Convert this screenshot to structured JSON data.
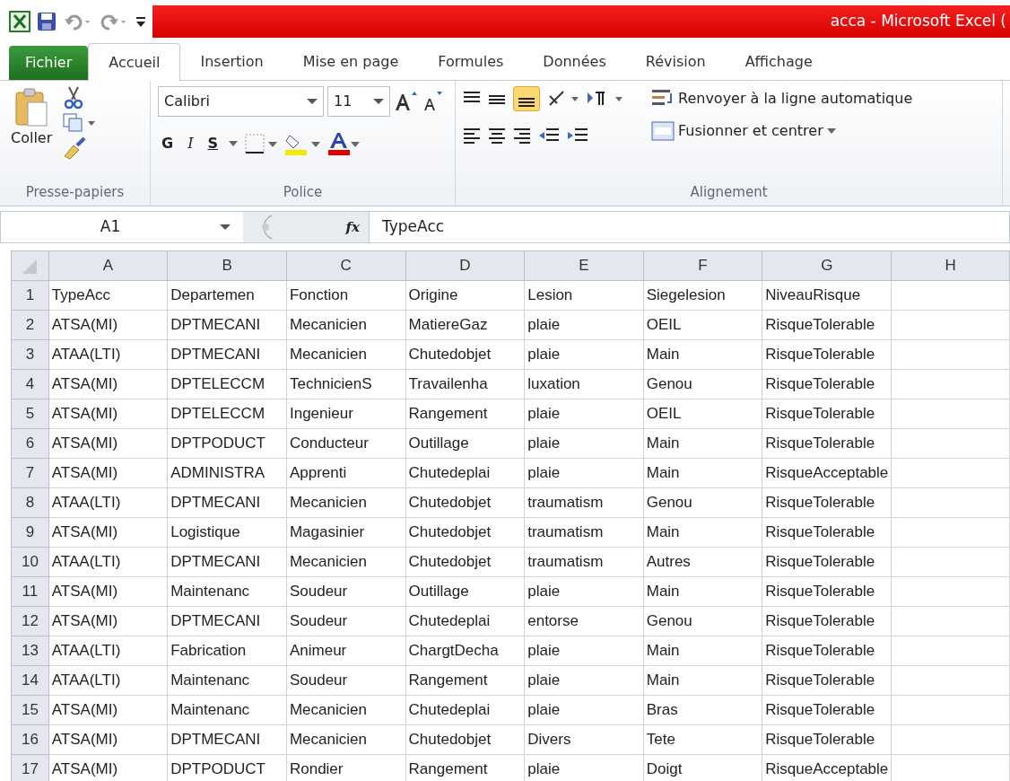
{
  "window": {
    "title": "acca -  Microsoft Excel ("
  },
  "file_tab": "Fichier",
  "tabs": [
    {
      "label": "Accueil",
      "selected": true
    },
    {
      "label": "Insertion",
      "selected": false
    },
    {
      "label": "Mise en page",
      "selected": false
    },
    {
      "label": "Formules",
      "selected": false
    },
    {
      "label": "Données",
      "selected": false
    },
    {
      "label": "Révision",
      "selected": false
    },
    {
      "label": "Affichage",
      "selected": false
    }
  ],
  "ribbon": {
    "clipboard": {
      "paste": "Coller",
      "group": "Presse-papiers"
    },
    "font": {
      "name": "Calibri",
      "size": "11",
      "bold": "G",
      "italic": "I",
      "underline": "S",
      "group": "Police"
    },
    "alignment": {
      "bottom_align_selected": true,
      "wrap": "Renvoyer à la ligne automatique",
      "merge": "Fusionner et centrer",
      "group": "Alignement"
    }
  },
  "formula_bar": {
    "name_box": "A1",
    "fx": "fx",
    "value": "TypeAcc"
  },
  "sheet": {
    "columns": [
      "A",
      "B",
      "C",
      "D",
      "E",
      "F",
      "G",
      "H"
    ],
    "rows": [
      {
        "number": "1",
        "cells": [
          "TypeAcc",
          "Departemen",
          "Fonction",
          "Origine",
          "Lesion",
          "Siegelesion",
          "NiveauRisque"
        ]
      },
      {
        "number": "2",
        "cells": [
          "ATSA(MI)",
          "DPTMECANI",
          "Mecanicien",
          "MatiereGaz",
          "plaie",
          "OEIL",
          "RisqueTolerable"
        ]
      },
      {
        "number": "3",
        "cells": [
          "ATAA(LTI)",
          "DPTMECANI",
          "Mecanicien",
          "Chutedobjet",
          "plaie",
          "Main",
          "RisqueTolerable"
        ]
      },
      {
        "number": "4",
        "cells": [
          "ATSA(MI)",
          "DPTELECCM",
          "TechnicienS",
          "Travailenha",
          "luxation",
          "Genou",
          "RisqueTolerable"
        ]
      },
      {
        "number": "5",
        "cells": [
          "ATSA(MI)",
          "DPTELECCM",
          "Ingenieur",
          "Rangement",
          "plaie",
          "OEIL",
          "RisqueTolerable"
        ]
      },
      {
        "number": "6",
        "cells": [
          "ATSA(MI)",
          "DPTPODUCT",
          "Conducteur",
          "Outillage",
          "plaie",
          "Main",
          "RisqueTolerable"
        ]
      },
      {
        "number": "7",
        "cells": [
          "ATSA(MI)",
          "ADMINISTRA",
          "Apprenti",
          "Chutedeplai",
          "plaie",
          "Main",
          "RisqueAcceptable"
        ]
      },
      {
        "number": "8",
        "cells": [
          "ATAA(LTI)",
          "DPTMECANI",
          "Mecanicien",
          "Chutedobjet",
          "traumatism",
          "Genou",
          "RisqueTolerable"
        ]
      },
      {
        "number": "9",
        "cells": [
          "ATSA(MI)",
          "Logistique",
          "Magasinier",
          "Chutedobjet",
          "traumatism",
          "Main",
          "RisqueTolerable"
        ]
      },
      {
        "number": "10",
        "cells": [
          "ATAA(LTI)",
          "DPTMECANI",
          "Mecanicien",
          "Chutedobjet",
          "traumatism",
          "Autres",
          "RisqueTolerable"
        ]
      },
      {
        "number": "11",
        "cells": [
          "ATSA(MI)",
          "Maintenanc",
          "Soudeur",
          "Outillage",
          "plaie",
          "Main",
          "RisqueTolerable"
        ]
      },
      {
        "number": "12",
        "cells": [
          "ATSA(MI)",
          "DPTMECANI",
          "Soudeur",
          "Chutedeplai",
          "entorse",
          "Genou",
          "RisqueTolerable"
        ]
      },
      {
        "number": "13",
        "cells": [
          "ATAA(LTI)",
          "Fabrication",
          "Animeur",
          "ChargtDecha",
          "plaie",
          "Main",
          "RisqueTolerable"
        ]
      },
      {
        "number": "14",
        "cells": [
          "ATAA(LTI)",
          "Maintenanc",
          "Soudeur",
          "Rangement",
          "plaie",
          "Main",
          "RisqueTolerable"
        ]
      },
      {
        "number": "15",
        "cells": [
          "ATSA(MI)",
          "Maintenanc",
          "Mecanicien",
          "Chutedeplai",
          "plaie",
          "Bras",
          "RisqueTolerable"
        ]
      },
      {
        "number": "16",
        "cells": [
          "ATSA(MI)",
          "DPTMECANI",
          "Mecanicien",
          "Chutedobjet",
          "Divers",
          "Tete",
          "RisqueTolerable"
        ]
      },
      {
        "number": "17",
        "cells": [
          "ATSA(MI)",
          "DPTPODUCT",
          "Rondier",
          "Rangement",
          "plaie",
          "Doigt",
          "RisqueAcceptable"
        ]
      }
    ]
  }
}
